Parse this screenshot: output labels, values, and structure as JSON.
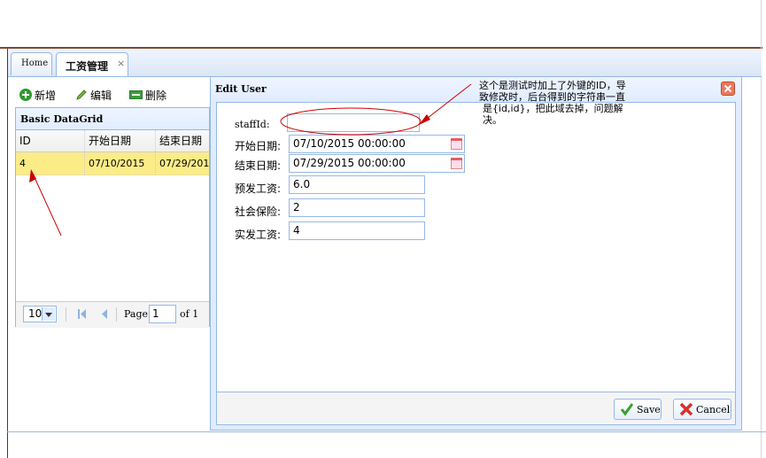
{
  "tabs": [
    {
      "label": "Home"
    },
    {
      "label": "工资管理",
      "close": "×"
    }
  ],
  "toolbar": {
    "add_label": "新增",
    "edit_label": "编辑",
    "remove_label": "删除",
    "add_icon": "add-icon",
    "edit_icon": "pencil-icon",
    "remove_icon": "remove-icon"
  },
  "grid": {
    "title": "Basic DataGrid",
    "columns": [
      "ID",
      "开始日期",
      "结束日期"
    ],
    "rows": [
      {
        "id": "4",
        "start": "07/10/2015",
        "end": "07/29/2015"
      }
    ],
    "selected_row_color": "#fbec88",
    "pager": {
      "page_size": "10",
      "page_label": "Page",
      "page_value": "1",
      "of_label": "of 1"
    }
  },
  "dialog": {
    "title": "Edit User",
    "fields": [
      {
        "label": "staffId:",
        "value": ""
      },
      {
        "label": "开始日期:",
        "value": "07/10/2015 00:00:00"
      },
      {
        "label": "结束日期:",
        "value": "07/29/2015 00:00:00"
      },
      {
        "label": "预发工资:",
        "value": "6.0"
      },
      {
        "label": "社会保险:",
        "value": "2"
      },
      {
        "label": "实发工资:",
        "value": "4"
      }
    ],
    "save_label": "Save",
    "cancel_label": "Cancel"
  },
  "annotation": {
    "lines": [
      "这个是测试时加上了外键的ID，导",
      "致修改时，后台得到的字符串一直",
      "是{id,id}，把此域去掉，问题解",
      "决。"
    ],
    "color": "#cc0000"
  },
  "colors": {
    "border": "#95b8e7",
    "panel_header": "#e0ecff",
    "accent_red": "#cc0000"
  }
}
